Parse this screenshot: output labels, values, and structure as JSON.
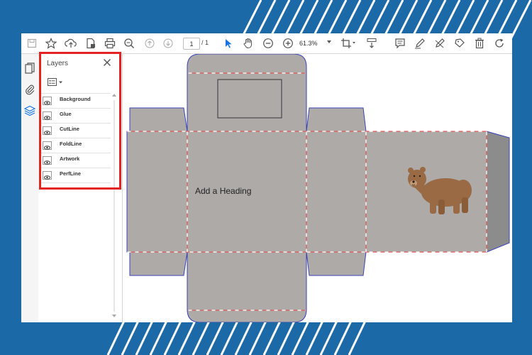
{
  "toolbar": {
    "page_current": "1",
    "page_separator": "/ 1",
    "zoom": "61.3%",
    "icons": [
      "save-icon",
      "bookmark-star-icon",
      "upload-cloud-icon",
      "protect-file-icon",
      "print-icon",
      "zoom-search-icon",
      "page-up-icon",
      "page-down-icon",
      "select-cursor-icon",
      "hand-tool-icon",
      "zoom-out-icon",
      "zoom-in-icon",
      "crop-tool-icon",
      "scroll-mode-icon",
      "comment-icon",
      "pen-icon",
      "highlighter-icon",
      "stamp-icon",
      "trash-icon",
      "redo-icon"
    ]
  },
  "left_rail": {
    "icons": [
      "pages-icon",
      "attachment-icon",
      "layers-icon"
    ]
  },
  "layers_panel": {
    "title": "Layers",
    "items": [
      {
        "label": "Background"
      },
      {
        "label": "Glue"
      },
      {
        "label": "CutLine"
      },
      {
        "label": "FoldLine"
      },
      {
        "label": "Artwork"
      },
      {
        "label": "PerfLine"
      }
    ]
  },
  "document": {
    "heading": "Add a Heading",
    "colors": {
      "box_fill": "#aeaaa8",
      "box_outline": "#3a43b8",
      "cut_line": "#e05a5a",
      "fold_line": "#ffffff",
      "side_fill": "#8c8c8c",
      "bear": "#9a6a44",
      "highlight": "#e52222",
      "background": "#1b6aa7"
    }
  }
}
